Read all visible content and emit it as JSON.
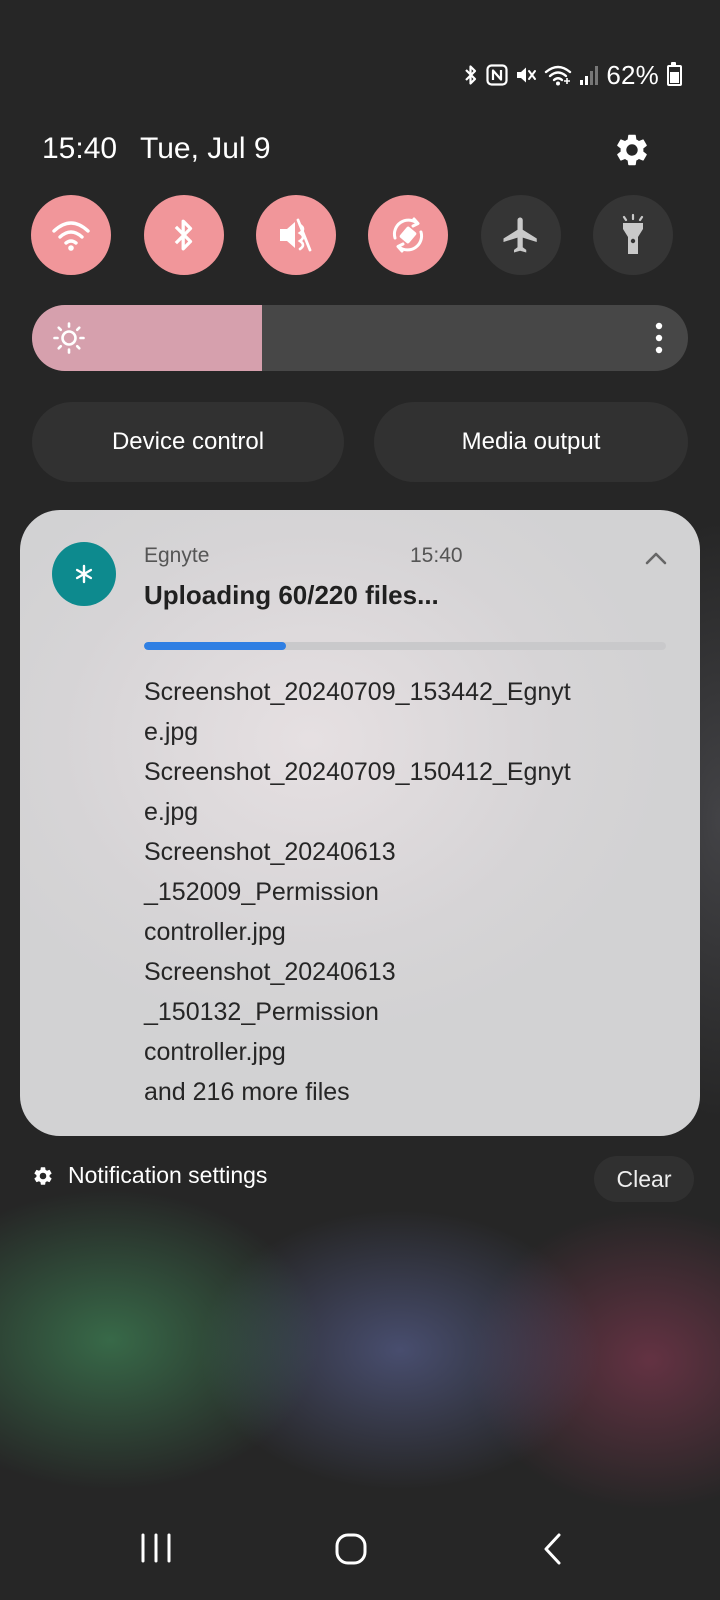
{
  "status_bar": {
    "battery": "62%",
    "icons": [
      "bluetooth-icon",
      "nfc-icon",
      "mute-icon",
      "wifi-icon",
      "signal-icon",
      "battery-icon"
    ]
  },
  "header": {
    "time": "15:40",
    "date": "Tue, Jul 9"
  },
  "quick_settings": [
    {
      "name": "wifi",
      "icon": "wifi-icon",
      "active": true
    },
    {
      "name": "bluetooth",
      "icon": "bluetooth-icon",
      "active": true
    },
    {
      "name": "sound",
      "icon": "mute-icon",
      "active": true
    },
    {
      "name": "auto-rotate",
      "icon": "auto-rotate-icon",
      "active": true
    },
    {
      "name": "airplane",
      "icon": "airplane-icon",
      "active": false
    },
    {
      "name": "flashlight",
      "icon": "flashlight-icon",
      "active": false
    }
  ],
  "brightness": {
    "level_fraction": 0.35
  },
  "buttons": {
    "device_control": "Device control",
    "media_output": "Media output"
  },
  "notification": {
    "app": "Egnyte",
    "time": "15:40",
    "title": "Uploading 60/220 files...",
    "progress": {
      "current": 60,
      "total": 220
    },
    "lines": [
      "Screenshot_20240709_153442_Egnyt",
      "e.jpg",
      "Screenshot_20240709_150412_Egnyt",
      "e.jpg",
      "Screenshot_20240613",
      "_152009_Permission",
      "controller.jpg",
      "Screenshot_20240613",
      "_150132_Permission",
      "controller.jpg",
      "and 216 more files"
    ]
  },
  "footer": {
    "notification_settings": "Notification settings",
    "clear": "Clear"
  },
  "colors": {
    "tile_active": "#f1969a",
    "tile_inactive": "#353535",
    "brightness_fill": "#d6a0ad",
    "progress": "#2f7fe3",
    "app_icon": "#0d8a8e"
  }
}
